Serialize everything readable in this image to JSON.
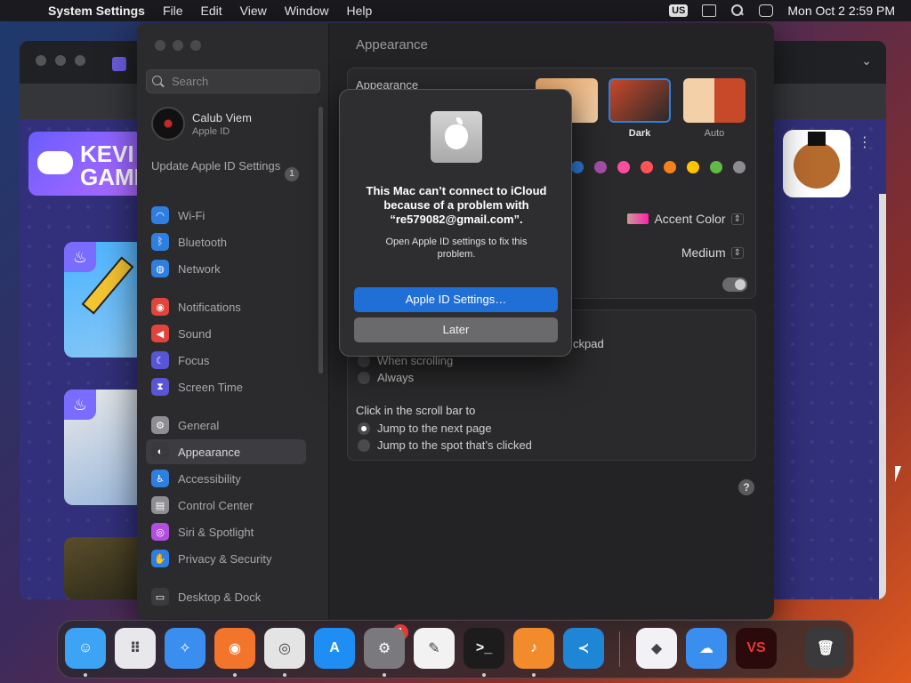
{
  "menubar": {
    "apple_glyph": "",
    "app_name": "System Settings",
    "items": [
      "File",
      "Edit",
      "View",
      "Window",
      "Help"
    ],
    "input_source": "US",
    "datetime": "Mon Oct 2  2:59 PM"
  },
  "browser": {
    "logo_text": "KEVI\nGAME"
  },
  "settings": {
    "search_placeholder": "Search",
    "user": {
      "name": "Calub Viem",
      "subtitle": "Apple ID"
    },
    "update": {
      "label": "Update Apple ID Settings",
      "count": "1"
    },
    "sidebar_items": [
      {
        "label": "Wi-Fi",
        "color": "#2f7fe0",
        "glyph": "◠"
      },
      {
        "label": "Bluetooth",
        "color": "#2f7fe0",
        "glyph": "ᛒ"
      },
      {
        "label": "Network",
        "color": "#2f7fe0",
        "glyph": "◍"
      },
      {
        "label": "Notifications",
        "color": "#e0443a",
        "glyph": "◉"
      },
      {
        "label": "Sound",
        "color": "#e0443a",
        "glyph": "◀"
      },
      {
        "label": "Focus",
        "color": "#5856d6",
        "glyph": "☾"
      },
      {
        "label": "Screen Time",
        "color": "#5856d6",
        "glyph": "⧗"
      },
      {
        "label": "General",
        "color": "#8e8e93",
        "glyph": "⚙"
      },
      {
        "label": "Appearance",
        "color": "#3a3a3c",
        "glyph": "◐"
      },
      {
        "label": "Accessibility",
        "color": "#2f7fe0",
        "glyph": "♿"
      },
      {
        "label": "Control Center",
        "color": "#8e8e93",
        "glyph": "▤"
      },
      {
        "label": "Siri & Spotlight",
        "color": "#b24fe0",
        "glyph": "◎"
      },
      {
        "label": "Privacy & Security",
        "color": "#2f7fe0",
        "glyph": "✋"
      },
      {
        "label": "Desktop & Dock",
        "color": "#3a3a3c",
        "glyph": "▭"
      }
    ],
    "active_item": "Appearance",
    "main": {
      "title": "Appearance",
      "appearance_label": "Appearance",
      "modes": [
        {
          "label": "nt"
        },
        {
          "label": "Dark"
        },
        {
          "label": "Auto"
        }
      ],
      "swatch_colors": [
        "#2f7fe0",
        "#a550a7",
        "#f74f9e",
        "#ff5257",
        "#f7821b",
        "#ffc600",
        "#62ba46",
        "#8c8c8c"
      ],
      "accent_label": "Accent Color",
      "sidebar_size_value": "Medium",
      "trackpad_fragment": "ckpad",
      "show_scrollbars_options": [
        "When scrolling",
        "Always"
      ],
      "scroll_click_label": "Click in the scroll bar to",
      "scroll_click_options": [
        "Jump to the next page",
        "Jump to the spot that’s clicked"
      ],
      "help_glyph": "?"
    }
  },
  "alert": {
    "title": "This Mac can’t connect to iCloud because of a problem with “re579082@gmail.com”.",
    "body": "Open Apple ID settings to fix this problem.",
    "primary_button": "Apple ID Settings…",
    "secondary_button": "Later"
  },
  "dock": {
    "apps": [
      {
        "name": "Finder",
        "color": "#3da3f5",
        "glyph": "☺",
        "running": true
      },
      {
        "name": "Launchpad",
        "color": "#e8e8ec",
        "glyph": "⠿",
        "running": false
      },
      {
        "name": "Safari",
        "color": "#3a8ef0",
        "glyph": "✧",
        "running": false
      },
      {
        "name": "Firefox",
        "color": "#f3752b",
        "glyph": "◉",
        "running": true
      },
      {
        "name": "Chrome",
        "color": "#e4e4e4",
        "glyph": "◎",
        "running": true
      },
      {
        "name": "App Store",
        "color": "#1e8ef4",
        "glyph": "A",
        "running": false
      },
      {
        "name": "System Settings",
        "color": "#7a7a7e",
        "glyph": "⚙",
        "running": true
      },
      {
        "name": "TextEdit",
        "color": "#f2f2f2",
        "glyph": "✎",
        "running": false
      },
      {
        "name": "Terminal",
        "color": "#1c1c1c",
        "glyph": ">_",
        "running": true
      },
      {
        "name": "GarageBand",
        "color": "#f18b2c",
        "glyph": "♪",
        "running": true
      },
      {
        "name": "VS Code",
        "color": "#1f86d6",
        "glyph": "≺",
        "running": false
      },
      {
        "name": "Visual Studio",
        "color": "#f2f2f6",
        "glyph": "◆",
        "running": false
      },
      {
        "name": "Weather",
        "color": "#3a8ef0",
        "glyph": "☁",
        "running": false
      },
      {
        "name": "VS",
        "color": "#2a0a0a",
        "glyph": "VS",
        "running": false
      },
      {
        "name": "Trash",
        "color": "#3a3a3c",
        "glyph": "🗑",
        "running": false
      }
    ],
    "settings_badge": "1"
  }
}
